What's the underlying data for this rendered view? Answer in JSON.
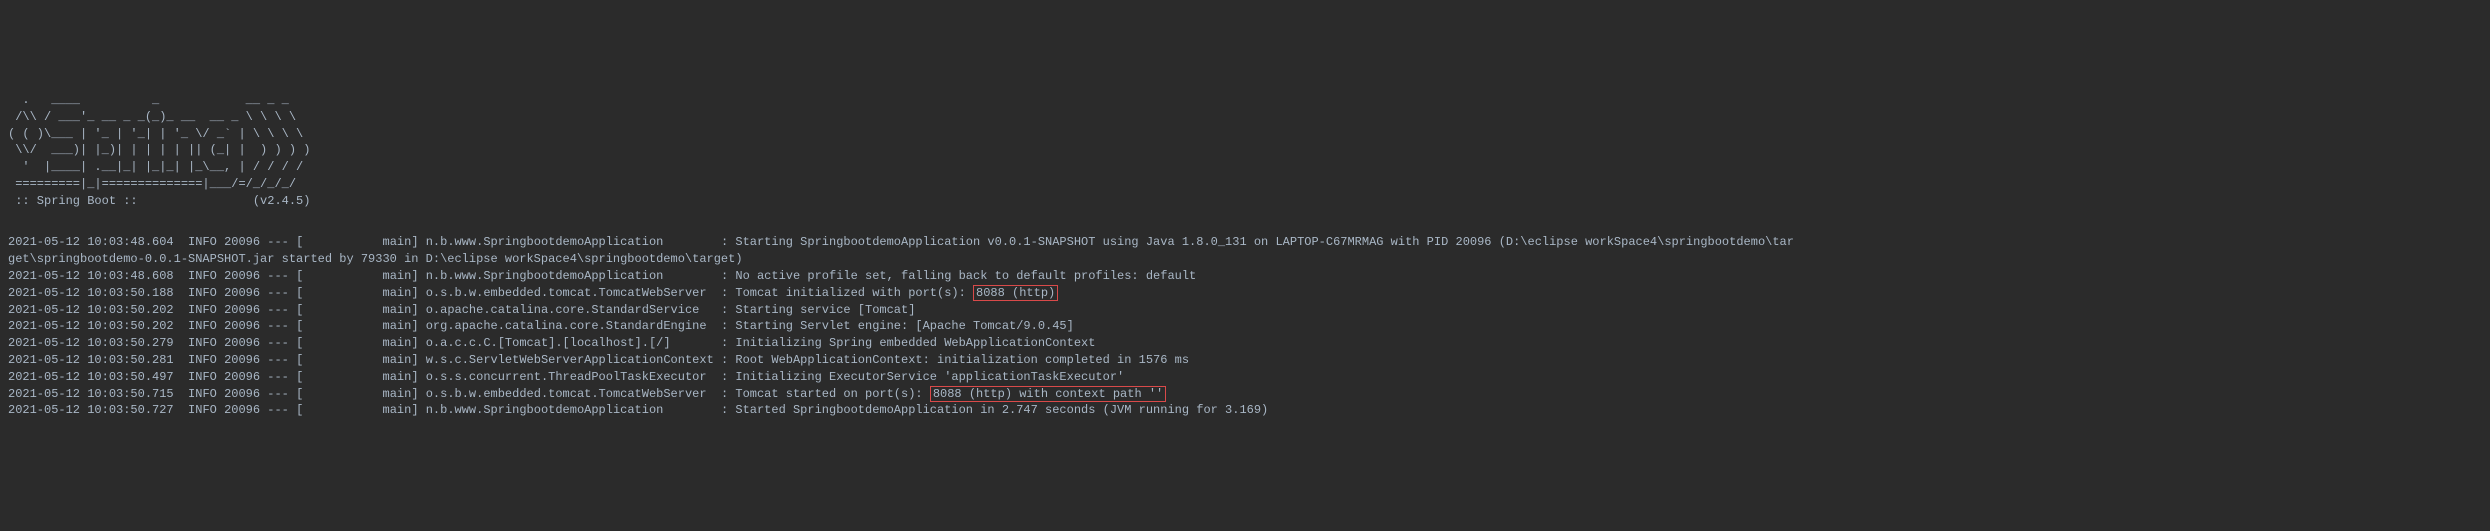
{
  "banner": {
    "line1": "  .   ____          _            __ _ _",
    "line2": " /\\\\ / ___'_ __ _ _(_)_ __  __ _ \\ \\ \\ \\",
    "line3": "( ( )\\___ | '_ | '_| | '_ \\/ _` | \\ \\ \\ \\",
    "line4": " \\\\/  ___)| |_)| | | | | || (_| |  ) ) ) )",
    "line5": "  '  |____| .__|_| |_|_| |_\\__, | / / / /",
    "line6": " =========|_|==============|___/=/_/_/_/",
    "line7": " :: Spring Boot ::                (v2.4.5)"
  },
  "logs": [
    {
      "timestamp": "2021-05-12 10:03:48.604",
      "level": "INFO",
      "pid": "20096",
      "sep": "---",
      "thread": "[           main]",
      "logger": "n.b.www.SpringbootdemoApplication       ",
      "message": ": Starting SpringbootdemoApplication v0.0.1-SNAPSHOT using Java 1.8.0_131 on LAPTOP-C67MRMAG with PID 20096 (D:\\eclipse workSpace4\\springbootdemo\\tar"
    },
    {
      "continuation": "get\\springbootdemo-0.0.1-SNAPSHOT.jar started by 79330 in D:\\eclipse workSpace4\\springbootdemo\\target)"
    },
    {
      "timestamp": "2021-05-12 10:03:48.608",
      "level": "INFO",
      "pid": "20096",
      "sep": "---",
      "thread": "[           main]",
      "logger": "n.b.www.SpringbootdemoApplication       ",
      "message": ": No active profile set, falling back to default profiles: default"
    },
    {
      "timestamp": "2021-05-12 10:03:50.188",
      "level": "INFO",
      "pid": "20096",
      "sep": "---",
      "thread": "[           main]",
      "logger": "o.s.b.w.embedded.tomcat.TomcatWebServer ",
      "message_prefix": ": Tomcat initialized with port(s): ",
      "highlight": "8088 (http)"
    },
    {
      "timestamp": "2021-05-12 10:03:50.202",
      "level": "INFO",
      "pid": "20096",
      "sep": "---",
      "thread": "[           main]",
      "logger": "o.apache.catalina.core.StandardService  ",
      "message": ": Starting service [Tomcat]"
    },
    {
      "timestamp": "2021-05-12 10:03:50.202",
      "level": "INFO",
      "pid": "20096",
      "sep": "---",
      "thread": "[           main]",
      "logger": "org.apache.catalina.core.StandardEngine ",
      "message": ": Starting Servlet engine: [Apache Tomcat/9.0.45]"
    },
    {
      "timestamp": "2021-05-12 10:03:50.279",
      "level": "INFO",
      "pid": "20096",
      "sep": "---",
      "thread": "[           main]",
      "logger": "o.a.c.c.C.[Tomcat].[localhost].[/]      ",
      "message": ": Initializing Spring embedded WebApplicationContext"
    },
    {
      "timestamp": "2021-05-12 10:03:50.281",
      "level": "INFO",
      "pid": "20096",
      "sep": "---",
      "thread": "[           main]",
      "logger": "w.s.c.ServletWebServerApplicationContext",
      "message": ": Root WebApplicationContext: initialization completed in 1576 ms"
    },
    {
      "timestamp": "2021-05-12 10:03:50.497",
      "level": "INFO",
      "pid": "20096",
      "sep": "---",
      "thread": "[           main]",
      "logger": "o.s.s.concurrent.ThreadPoolTaskExecutor ",
      "message": ": Initializing ExecutorService 'applicationTaskExecutor'"
    },
    {
      "timestamp": "2021-05-12 10:03:50.715",
      "level": "INFO",
      "pid": "20096",
      "sep": "---",
      "thread": "[           main]",
      "logger": "o.s.b.w.embedded.tomcat.TomcatWebServer ",
      "message_prefix": ": Tomcat started on port(s): ",
      "highlight": "8088 (http) with context path ''"
    },
    {
      "timestamp": "2021-05-12 10:03:50.727",
      "level": "INFO",
      "pid": "20096",
      "sep": "---",
      "thread": "[           main]",
      "logger": "n.b.www.SpringbootdemoApplication       ",
      "message": ": Started SpringbootdemoApplication in 2.747 seconds (JVM running for 3.169)"
    }
  ]
}
